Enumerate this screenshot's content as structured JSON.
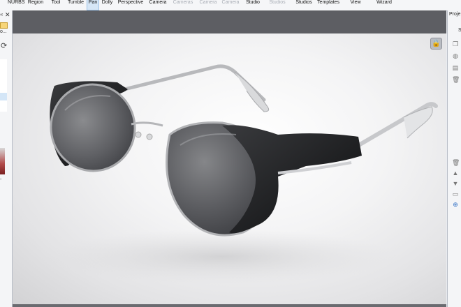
{
  "ribbon": {
    "items": [
      {
        "lines": [
          "",
          "NURBS"
        ],
        "dim": false
      },
      {
        "lines": [
          "",
          "Region"
        ],
        "dim": false
      },
      {
        "lines": [
          "",
          "Tool"
        ],
        "dim": false
      },
      {
        "lines": [
          "Tumble",
          ""
        ],
        "dim": false
      },
      {
        "lines": [
          "Pan",
          ""
        ],
        "dim": false
      },
      {
        "lines": [
          "Dolly",
          ""
        ],
        "dim": false
      },
      {
        "lines": [
          "Perspective",
          ""
        ],
        "dim": false
      },
      {
        "lines": [
          "",
          "Camera"
        ],
        "dim": false
      },
      {
        "lines": [
          "",
          "Cameras"
        ],
        "dim": true
      },
      {
        "lines": [
          "",
          "Camera"
        ],
        "dim": true
      },
      {
        "lines": [
          "",
          "Camera"
        ],
        "dim": true
      },
      {
        "lines": [
          "",
          "Studio"
        ],
        "dim": false
      },
      {
        "lines": [
          "",
          "Studios"
        ],
        "dim": true
      },
      {
        "lines": [
          "Studios",
          ""
        ],
        "dim": false
      },
      {
        "lines": [
          "",
          "Templates"
        ],
        "dim": false
      },
      {
        "lines": [
          "",
          "View"
        ],
        "dim": false
      },
      {
        "lines": [
          "",
          "Wizard"
        ],
        "dim": false
      }
    ]
  },
  "left_panel": {
    "arrow": "«",
    "close": "✕",
    "folder_text": "o...",
    "refresh_icon": "⟳",
    "dash": "-"
  },
  "right_panel": {
    "header": "Proje",
    "s_label": "S"
  },
  "viewport": {
    "camera_icon": "🔒"
  }
}
